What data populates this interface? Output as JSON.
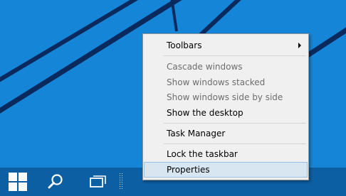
{
  "desktop": {
    "background_color": "#1585d8",
    "line_color": "#0a2a5e"
  },
  "taskbar": {
    "color": "#0c5fa3",
    "icons": [
      "windows-logo-icon",
      "search-icon",
      "task-view-icon",
      "toolbar-grip"
    ]
  },
  "context_menu": {
    "items": [
      {
        "label": "Toolbars",
        "enabled": true,
        "has_submenu": true
      },
      {
        "label": "Cascade windows",
        "enabled": false
      },
      {
        "label": "Show windows stacked",
        "enabled": false
      },
      {
        "label": "Show windows side by side",
        "enabled": false
      },
      {
        "label": "Show the desktop",
        "enabled": true
      },
      {
        "label": "Task Manager",
        "enabled": true
      },
      {
        "label": "Lock the taskbar",
        "enabled": true
      },
      {
        "label": "Properties",
        "enabled": true,
        "highlighted": true
      }
    ]
  }
}
